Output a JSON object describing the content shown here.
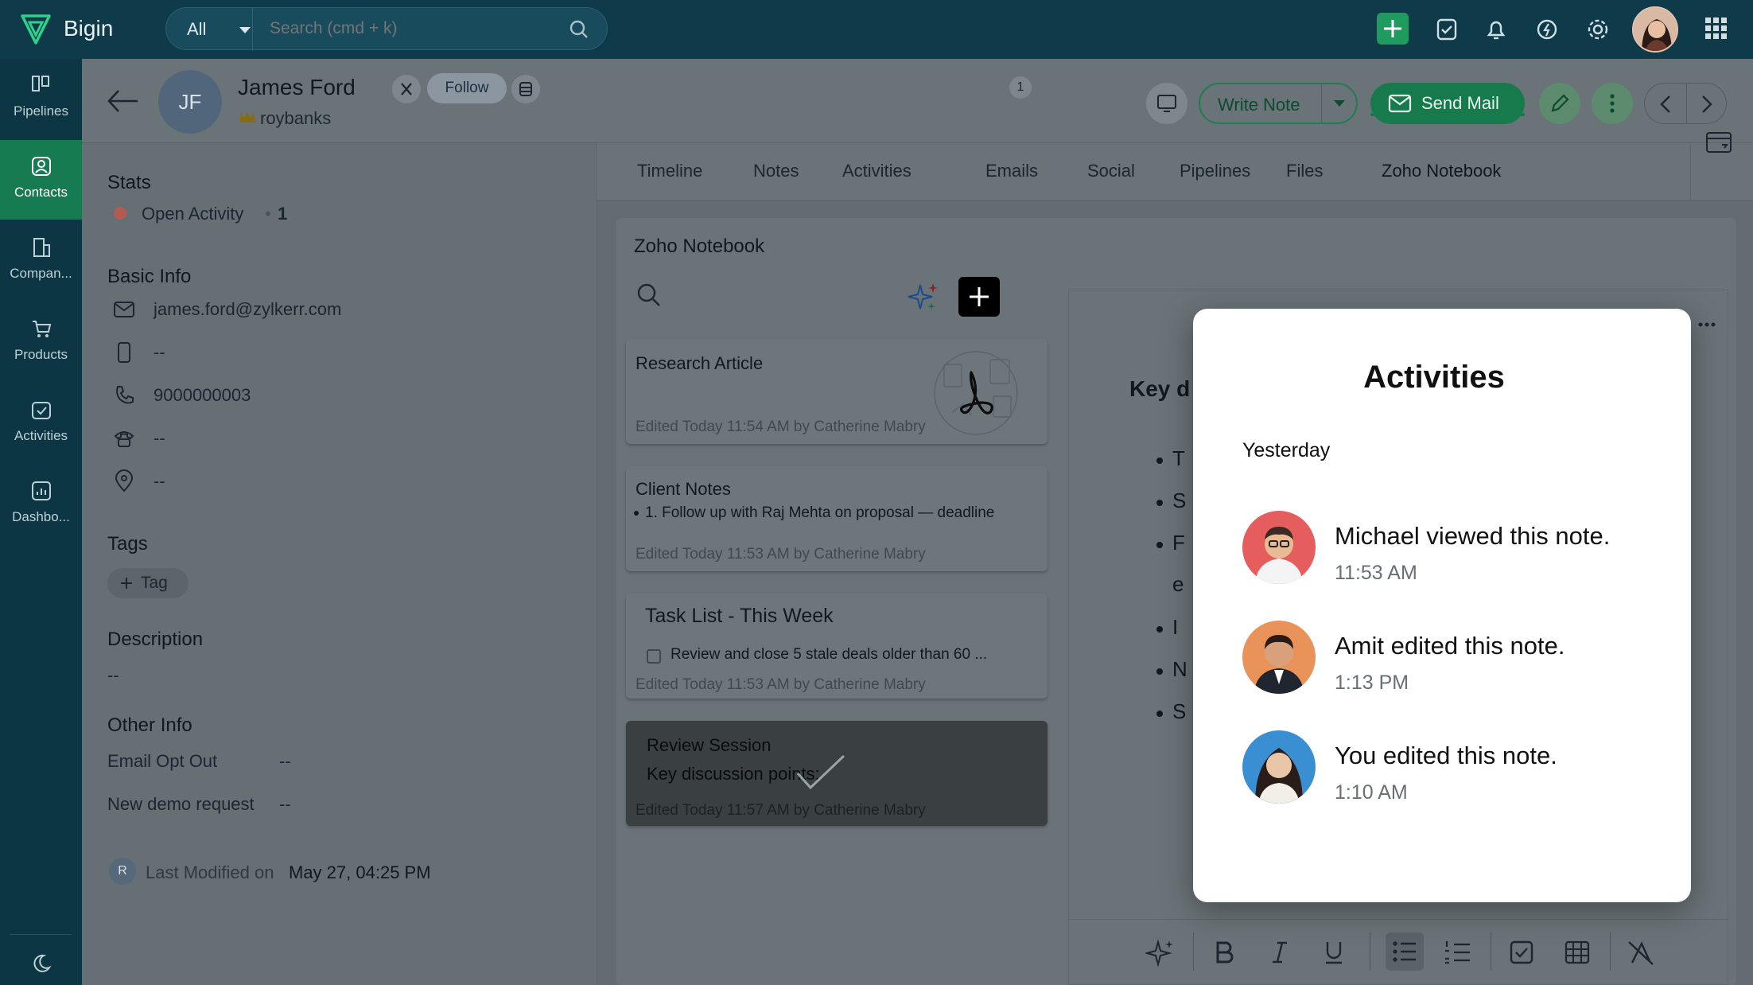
{
  "app": {
    "name": "Bigin"
  },
  "search": {
    "scope": "All",
    "placeholder": "Search (cmd + k)"
  },
  "sidebar": {
    "items": [
      {
        "label": "Pipelines",
        "icon": "pipelines-icon"
      },
      {
        "label": "Contacts",
        "icon": "contacts-icon",
        "active": true
      },
      {
        "label": "Compan...",
        "icon": "companies-icon"
      },
      {
        "label": "Products",
        "icon": "products-icon"
      },
      {
        "label": "Activities",
        "icon": "activities-icon"
      },
      {
        "label": "Dashbo...",
        "icon": "dashboard-icon"
      }
    ]
  },
  "contact": {
    "initials": "JF",
    "name": "James Ford",
    "owner": "roybanks",
    "follow_label": "Follow"
  },
  "actions": {
    "write_note": "Write Note",
    "send_mail": "Send Mail"
  },
  "stats": {
    "title": "Stats",
    "label": "Open Activity",
    "separator": "•",
    "count": "1"
  },
  "basic_info": {
    "title": "Basic Info",
    "email": "james.ford@zylkerr.com",
    "mobile": "--",
    "phone": "9000000003",
    "other_phone": "--",
    "address": "--"
  },
  "tags": {
    "title": "Tags",
    "add_label": "Tag"
  },
  "description": {
    "title": "Description",
    "value": "--"
  },
  "other_info": {
    "title": "Other Info",
    "rows": [
      {
        "label": "Email Opt Out",
        "value": "--"
      },
      {
        "label": "New demo request",
        "value": "--"
      }
    ]
  },
  "last_modified": {
    "initial": "R",
    "label": "Last Modified on",
    "value": "May 27, 04:25 PM"
  },
  "tabs": [
    {
      "label": "Timeline"
    },
    {
      "label": "Notes"
    },
    {
      "label": "Activities",
      "badge": "1"
    },
    {
      "label": "Emails"
    },
    {
      "label": "Social"
    },
    {
      "label": "Pipelines"
    },
    {
      "label": "Files"
    },
    {
      "label": "Zoho Notebook",
      "active": true
    }
  ],
  "notebook": {
    "title": "Zoho Notebook",
    "notes": [
      {
        "title": "Research Article",
        "meta": "Edited Today 11:54 AM by Catherine Mabry"
      },
      {
        "title": "Client Notes",
        "body": "1. Follow up with Raj Mehta on proposal — deadline",
        "meta": "Edited Today 11:53 AM by Catherine Mabry"
      },
      {
        "title": "Task List - This Week",
        "body": "Review and close 5 stale deals older than 60 ...",
        "meta": "Edited Today 11:53 AM by Catherine Mabry"
      },
      {
        "title": "Review Session",
        "body": "Key discussion points:",
        "meta": "Edited Today 11:57 AM by Catherine Mabry"
      }
    ],
    "editor": {
      "heading": "Key d",
      "bullets": [
        "T",
        "S",
        "F",
        "e",
        "I",
        "N",
        "S"
      ]
    }
  },
  "activities_popup": {
    "title": "Activities",
    "day": "Yesterday",
    "items": [
      {
        "text": "Michael viewed this note.",
        "time": "11:53 AM",
        "color": "#e65d5d"
      },
      {
        "text": "Amit edited this note.",
        "time": "1:13 PM",
        "color": "#e9935a"
      },
      {
        "text": "You edited this note.",
        "time": "1:10 AM",
        "color": "#3a8fd3"
      }
    ]
  },
  "colors": {
    "accent": "#1f9b5e",
    "topbar": "#0e3a4a",
    "overlay": "#626b70"
  }
}
